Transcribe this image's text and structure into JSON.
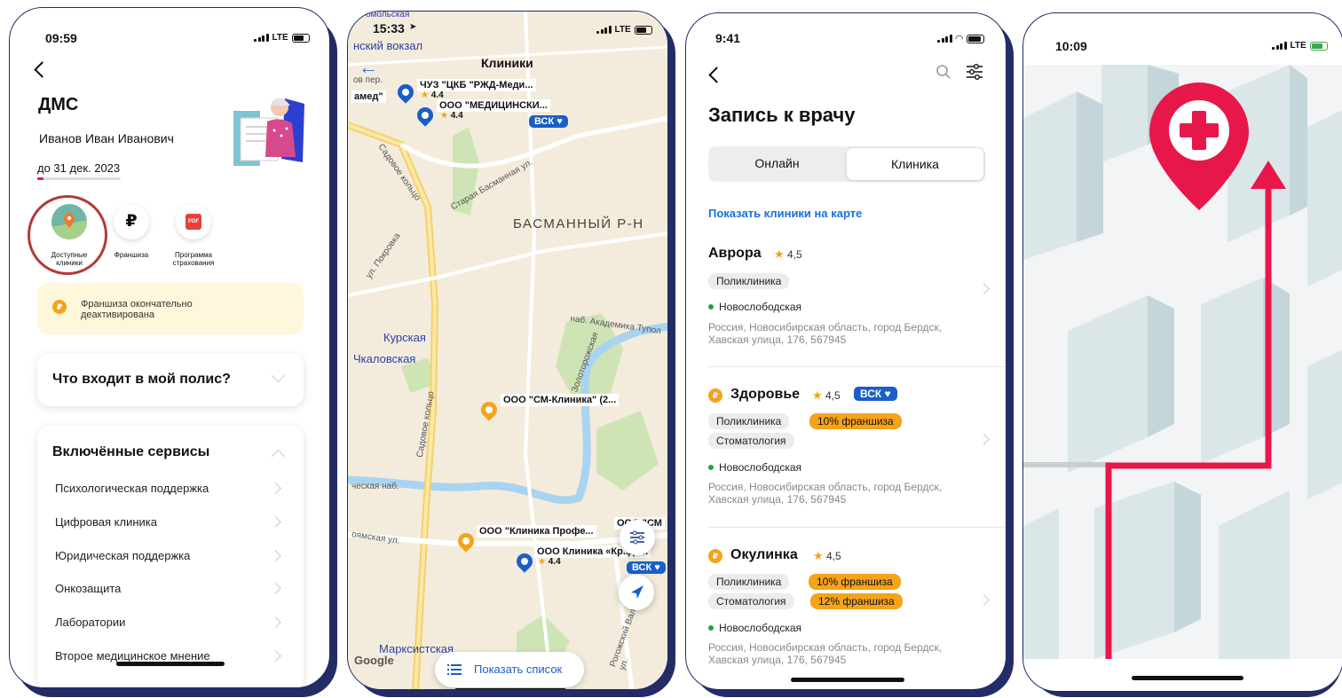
{
  "phone1": {
    "time": "09:59",
    "network": "LTE",
    "title": "ДМС",
    "holder": "Иванов Иван Иванович",
    "valid_until": "до 31 дек. 2023",
    "shortcuts": [
      {
        "label": "Доступные клиники",
        "icon": "map-pin-icon"
      },
      {
        "label": "Франшиза",
        "icon": "ruble-icon"
      },
      {
        "label": "Программа страхования",
        "icon": "pdf-icon"
      }
    ],
    "notice": "Франшиза окончательно деактивирована",
    "policy_title": "Что входит в мой полис?",
    "services_title": "Включённые сервисы",
    "services": [
      "Психологическая поддержка",
      "Цифровая клиника",
      "Юридическая поддержка",
      "Онкозащита",
      "Лаборатории",
      "Второе медицинское мнение"
    ]
  },
  "phone2": {
    "time": "15:33",
    "network": "LTE",
    "title": "Клиники",
    "top_street": "омольская",
    "station_top": "нский вокзал",
    "district": "БАСМАННЫЙ Р-Н",
    "clinics": [
      {
        "name": "ЧУЗ \"ЦКБ \"РЖД-Меди...",
        "rating": "4.4"
      },
      {
        "name": "ООО \"МЕДИЦИНСКИ...",
        "rating": "4.4",
        "badge": "ВСК"
      },
      {
        "name": "ООО \"СМ-Клиника\" (2..."
      },
      {
        "name": "ООО \"Клиника Профе..."
      },
      {
        "name": "ООО Клиника «Кр..де...",
        "rating": "4.4",
        "badge": "ВСК"
      },
      {
        "name": "ООО \"СМ"
      }
    ],
    "left_cut": "амед\"",
    "streets": [
      "ов пер.",
      "Садовое кольцо",
      "Старая Басманная ул.",
      "ул. Покровка",
      "Садовое кольцо",
      "ческая наб.",
      "оямская ул.",
      "Рогожский Вал ул.",
      "наб. Академика Тупол",
      "Золоторожская"
    ],
    "metro": [
      "Курская",
      "Чкаловская",
      "Марксистская"
    ],
    "google": "Google",
    "show_list": "Показать список"
  },
  "phone3": {
    "time": "9:41",
    "title": "Запись к врачу",
    "seg_online": "Онлайн",
    "seg_clinic": "Клиника",
    "show_map": "Показать клиники на карте",
    "clinics": [
      {
        "name": "Аврора",
        "rating": "4,5",
        "tags": [
          "Поликлиника"
        ],
        "metro": "Новослободская",
        "address": "Россия, Новосибирская область, город Бердск, Хавская улица, 176, 567945"
      },
      {
        "name": "Здоровье",
        "rating": "4,5",
        "badge": "ВСК",
        "tags": [
          "Поликлиника",
          "10% франшиза",
          "Стоматология"
        ],
        "metro": "Новослободская",
        "address": "Россия, Новосибирская область, город Бердск, Хавская улица, 176, 567945"
      },
      {
        "name": "Окулинка",
        "rating": "4,5",
        "tags": [
          "Поликлиника",
          "10% франшиза",
          "Стоматология",
          "12% франшиза"
        ],
        "metro": "Новослободская",
        "address": "Россия, Новосибирская область, город Бердск, Хавская улица, 176, 567945"
      }
    ]
  },
  "phone4": {
    "time": "10:09",
    "network": "LTE"
  },
  "colors": {
    "frame": "#242c66",
    "accent_red": "#e8174a",
    "blue_link": "#1a6fe0",
    "orange": "#f5a31a"
  }
}
